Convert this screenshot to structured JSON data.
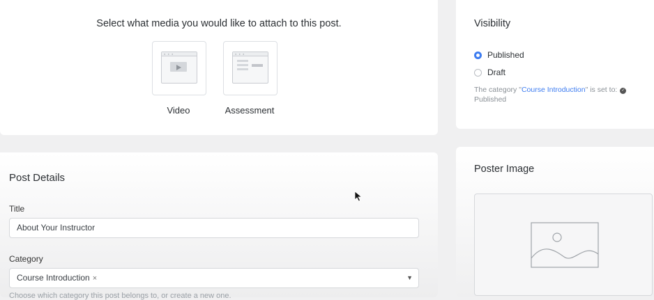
{
  "media": {
    "prompt": "Select what media you would like to attach to this post.",
    "options": [
      {
        "label": "Video",
        "icon": "video-layout-icon"
      },
      {
        "label": "Assessment",
        "icon": "assessment-layout-icon"
      }
    ]
  },
  "details": {
    "title": "Post Details",
    "title_label": "Title",
    "title_value": "About Your Instructor",
    "category_label": "Category",
    "category_value": "Course Introduction",
    "category_remove": "×",
    "category_hint": "Choose which category this post belongs to, or create a new one."
  },
  "visibility": {
    "title": "Visibility",
    "options": [
      {
        "label": "Published",
        "selected": true
      },
      {
        "label": "Draft",
        "selected": false
      }
    ],
    "note_prefix": "The category \"",
    "note_link": "Course Introduction",
    "note_suffix": "\" is set to:",
    "note_status": "Published"
  },
  "poster": {
    "title": "Poster Image",
    "placeholder_icon": "image-placeholder-icon"
  },
  "colors": {
    "accent": "#3d7cf0",
    "background": "#f0f0f1",
    "card": "#ffffff"
  }
}
